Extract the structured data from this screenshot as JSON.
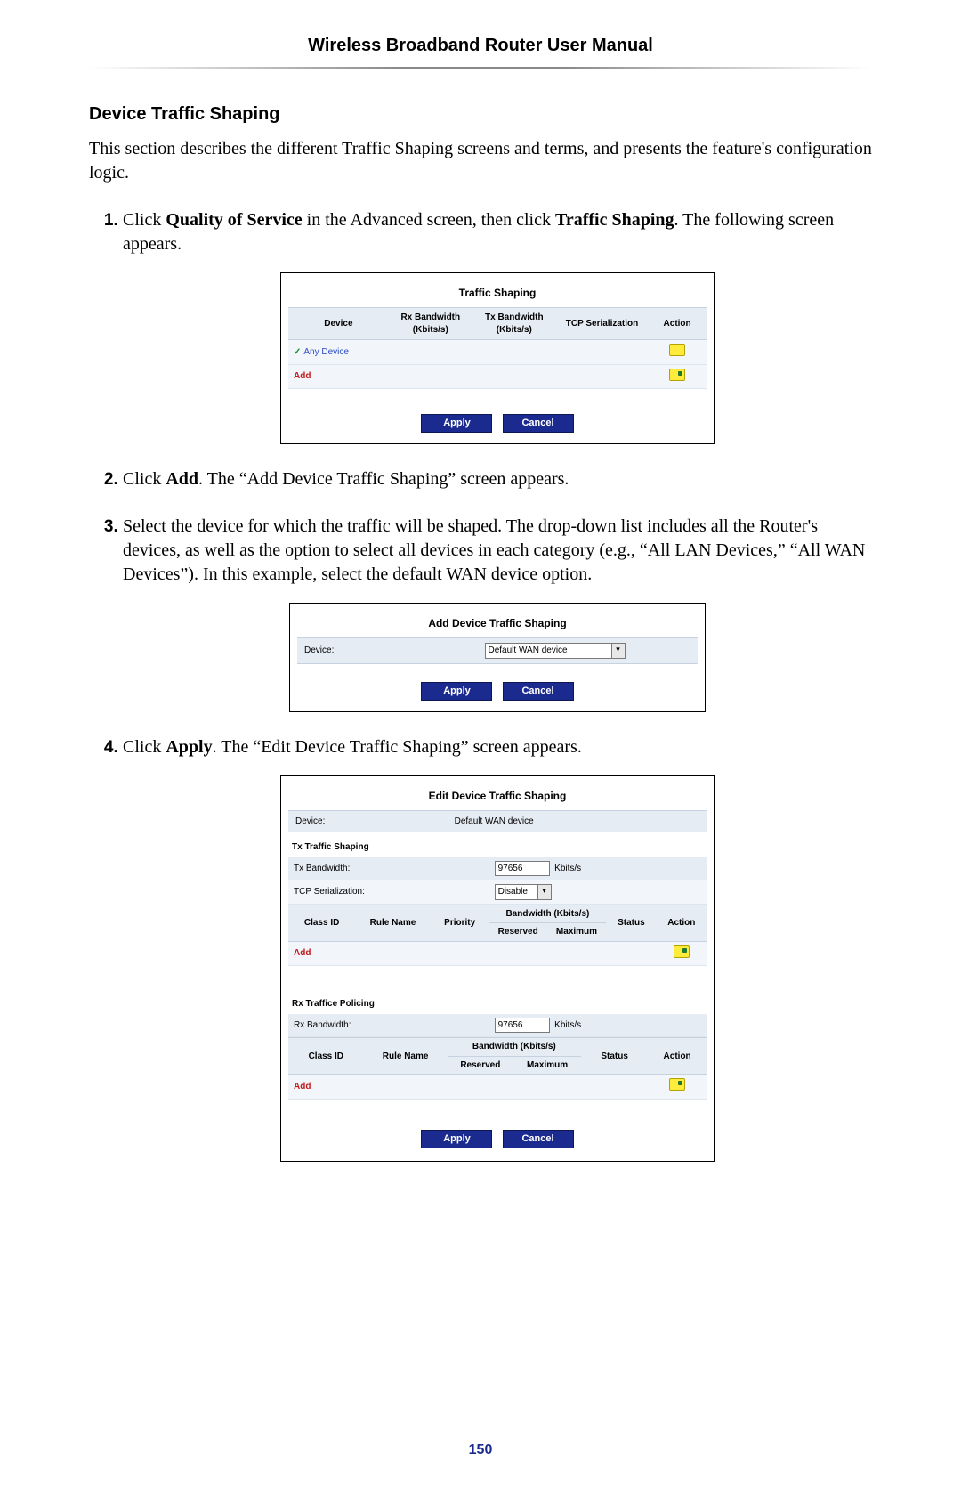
{
  "header": {
    "title": "Wireless Broadband Router User Manual"
  },
  "section": {
    "heading": "Device Traffic Shaping",
    "intro": "This section describes the different Traffic Shaping screens and terms, and presents the feature's configuration logic."
  },
  "steps": {
    "s1a": "Click ",
    "s1b": "Quality of Service",
    "s1c": " in the Advanced screen, then click ",
    "s1d": "Traffic Shaping",
    "s1e": ". The following screen appears.",
    "s2a": "Click ",
    "s2b": "Add",
    "s2c": ". The “Add Device Traffic Shaping” screen appears.",
    "s3": "Select the device for which the traffic will be shaped. The drop-down list includes all the Router's devices, as well as the option to select all devices in each category (e.g., “All LAN Devices,” “All WAN Devices”). In this example, select the default WAN device option.",
    "s4a": "Click ",
    "s4b": "Apply",
    "s4c": ". The “Edit Device Traffic Shaping” screen appears."
  },
  "fig1": {
    "title": "Traffic Shaping",
    "cols": {
      "device": "Device",
      "rx": "Rx Bandwidth (Kbits/s)",
      "tx": "Tx Bandwidth (Kbits/s)",
      "tcp": "TCP Serialization",
      "action": "Action"
    },
    "row_any": "Any Device",
    "add": "Add",
    "apply": "Apply",
    "cancel": "Cancel"
  },
  "fig2": {
    "title": "Add Device Traffic Shaping",
    "device_label": "Device:",
    "device_value": "Default WAN device",
    "apply": "Apply",
    "cancel": "Cancel"
  },
  "fig3": {
    "title": "Edit Device Traffic Shaping",
    "device_label": "Device:",
    "device_value": "Default WAN device",
    "tx_section": "Tx Traffic Shaping",
    "tx_bw_label": "Tx Bandwidth:",
    "tx_bw_value": "97656",
    "tx_bw_unit": "Kbits/s",
    "tcp_label": "TCP Serialization:",
    "tcp_value": "Disable",
    "classcols": {
      "classid": "Class ID",
      "rulename": "Rule Name",
      "priority": "Priority",
      "bw": "Bandwidth (Kbits/s)",
      "reserved": "Reserved",
      "maximum": "Maximum",
      "status": "Status",
      "action": "Action"
    },
    "add1": "Add",
    "rx_section": "Rx Traffice Policing",
    "rx_bw_label": "Rx Bandwidth:",
    "rx_bw_value": "97656",
    "rx_bw_unit": "Kbits/s",
    "add2": "Add",
    "apply": "Apply",
    "cancel": "Cancel"
  },
  "page_number": "150"
}
